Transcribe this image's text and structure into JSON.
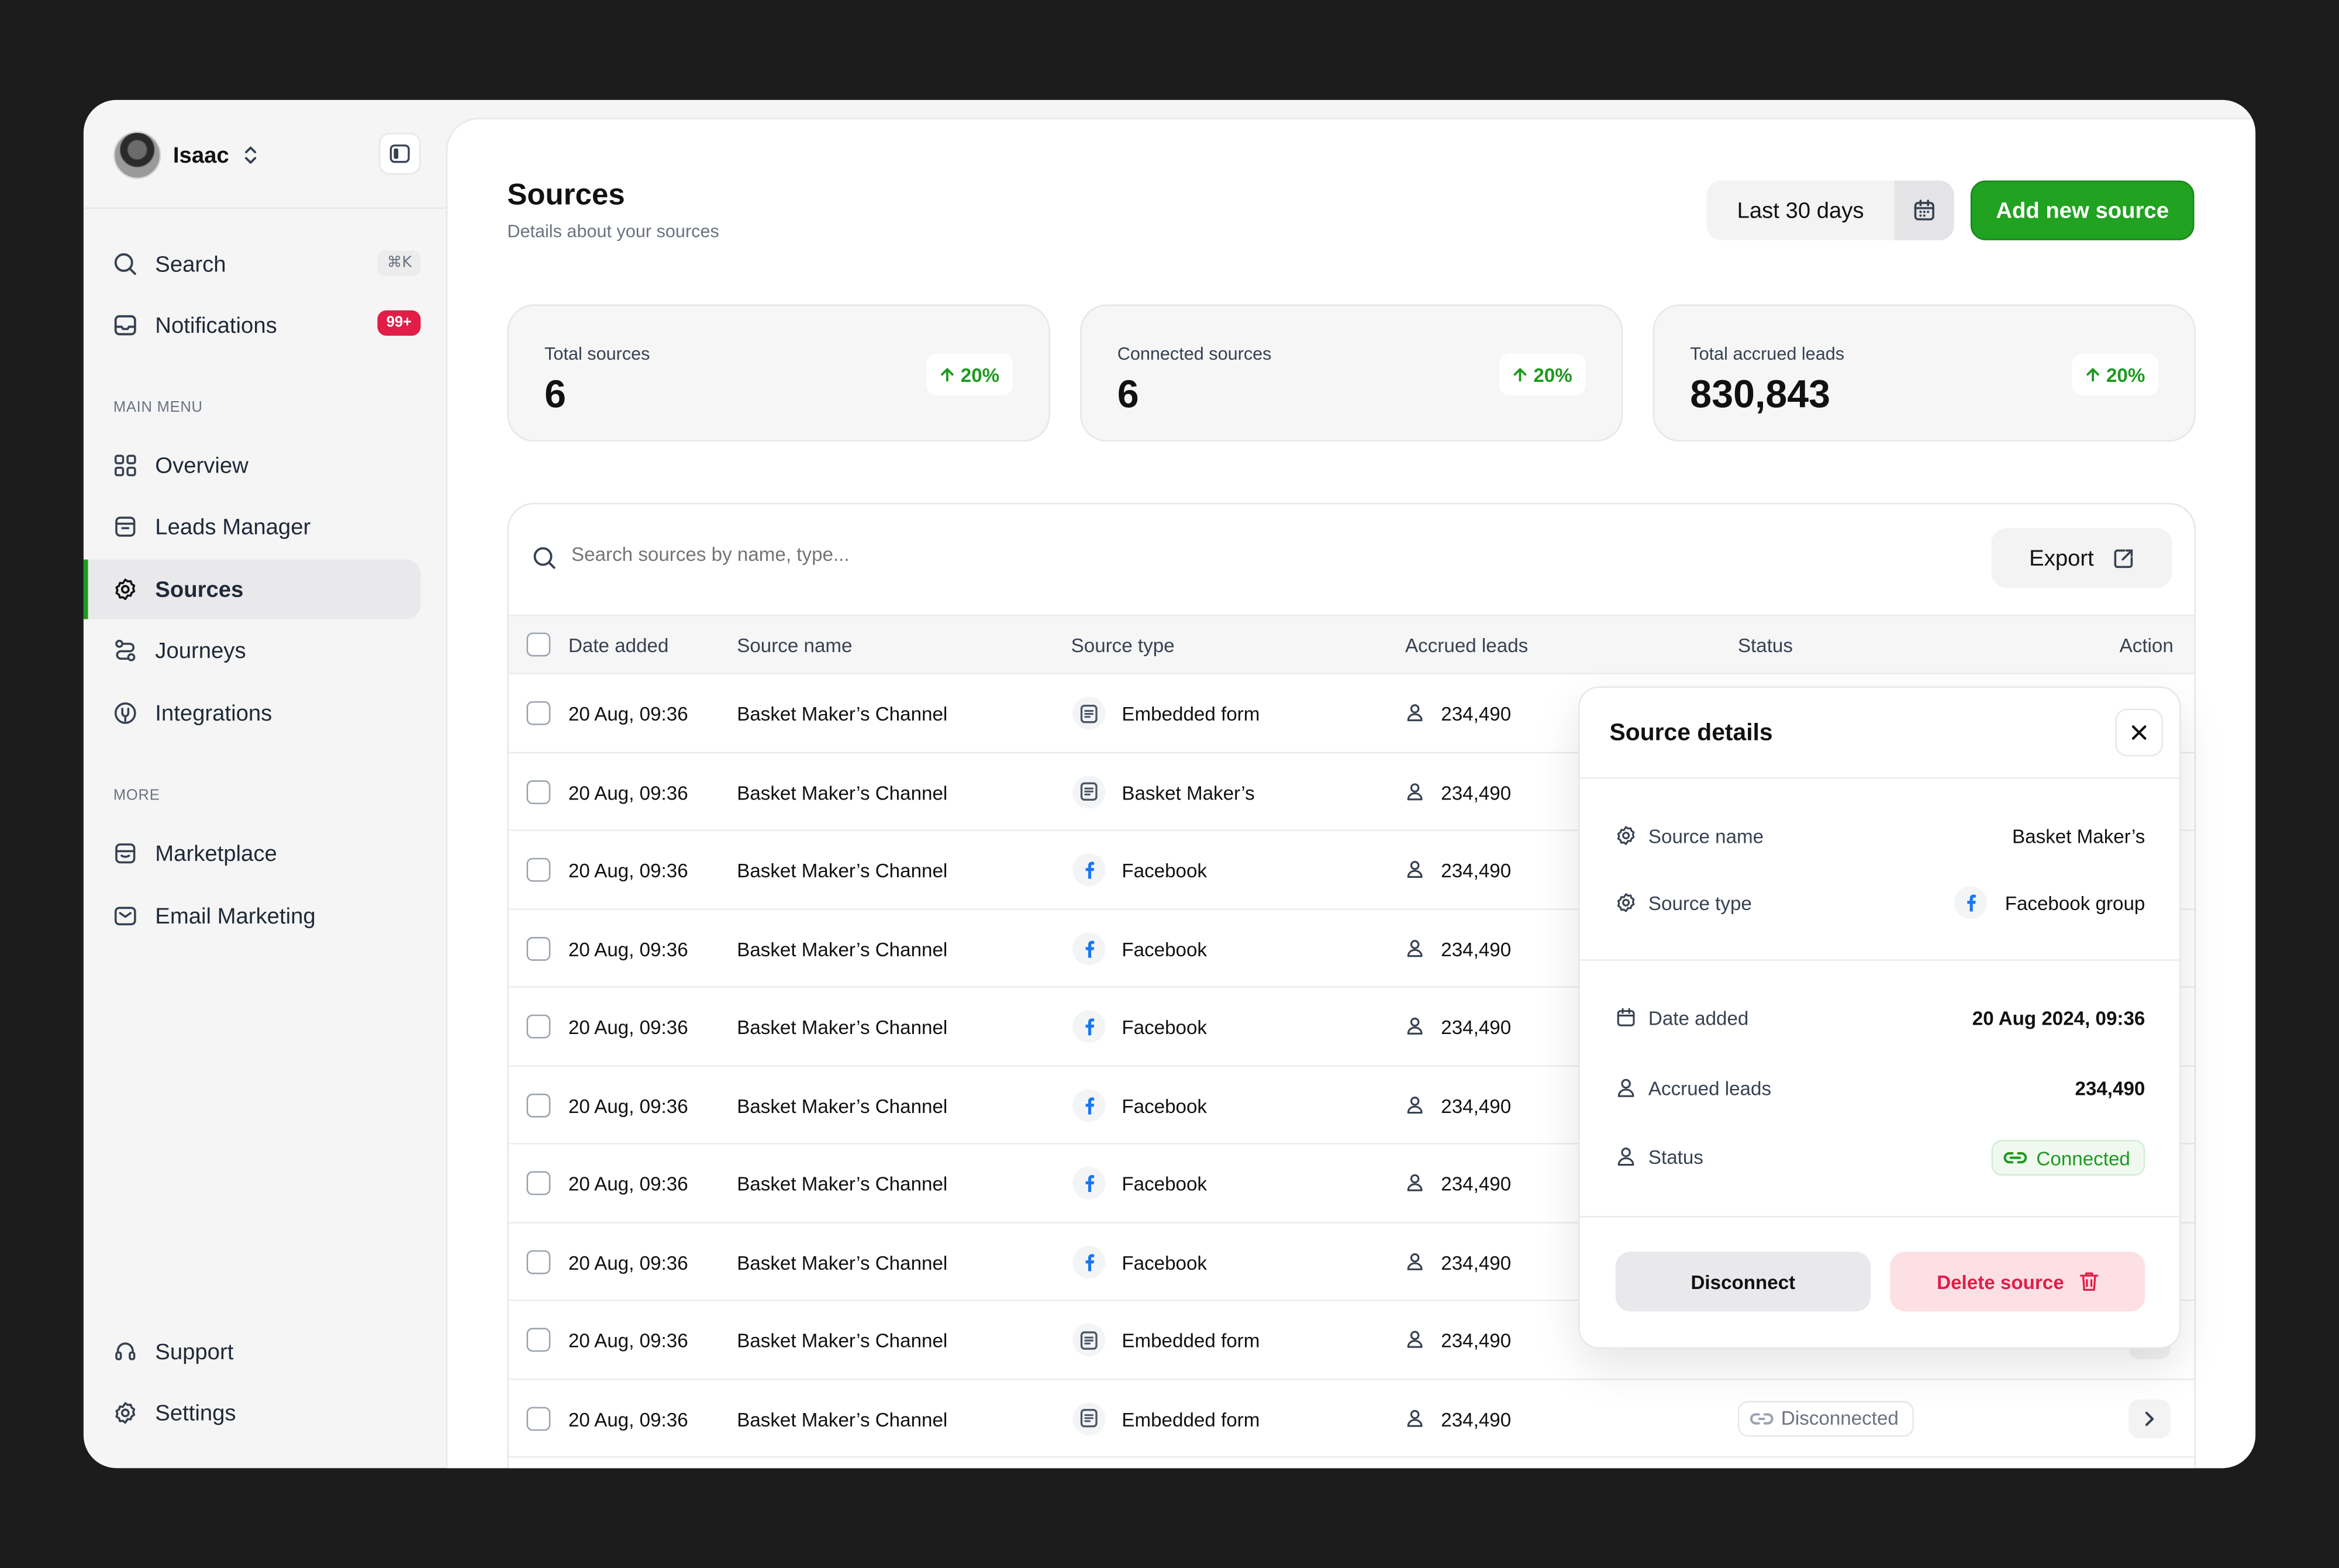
{
  "user": {
    "name": "Isaac"
  },
  "sidebar": {
    "search": {
      "label": "Search",
      "shortcut": "⌘K"
    },
    "notifications": {
      "label": "Notifications",
      "badge": "99+"
    },
    "main_menu_label": "MAIN MENU",
    "main_items": [
      {
        "label": "Overview",
        "icon": "grid-icon"
      },
      {
        "label": "Leads Manager",
        "icon": "box-icon"
      },
      {
        "label": "Sources",
        "icon": "gear-badge-icon",
        "active": true
      },
      {
        "label": "Journeys",
        "icon": "route-icon"
      },
      {
        "label": "Integrations",
        "icon": "puzzle-icon"
      }
    ],
    "more_label": "MORE",
    "more_items": [
      {
        "label": "Marketplace",
        "icon": "store-icon"
      },
      {
        "label": "Email Marketing",
        "icon": "mail-icon"
      }
    ],
    "bottom_items": [
      {
        "label": "Support",
        "icon": "headset-icon"
      },
      {
        "label": "Settings",
        "icon": "gear-icon"
      }
    ]
  },
  "header": {
    "title": "Sources",
    "subtitle": "Details about your sources",
    "date_range": "Last 30 days",
    "add_button": "Add new source"
  },
  "stats": [
    {
      "label": "Total sources",
      "value": "6",
      "change": "20%"
    },
    {
      "label": "Connected sources",
      "value": "6",
      "change": "20%"
    },
    {
      "label": "Total accrued leads",
      "value": "830,843",
      "change": "20%"
    }
  ],
  "table": {
    "search_placeholder": "Search sources by name, type...",
    "export_label": "Export",
    "columns": [
      "Date added",
      "Source name",
      "Source type",
      "Accrued leads",
      "Status",
      "Action"
    ],
    "rows": [
      {
        "date": "20 Aug, 09:36",
        "name": "Basket Maker’s Channel",
        "type": "Embedded form",
        "type_icon": "form-icon",
        "leads": "234,490"
      },
      {
        "date": "20 Aug, 09:36",
        "name": "Basket Maker’s Channel",
        "type": "Basket Maker’s",
        "type_icon": "form-icon",
        "leads": "234,490"
      },
      {
        "date": "20 Aug, 09:36",
        "name": "Basket Maker’s Channel",
        "type": "Facebook",
        "type_icon": "facebook-icon",
        "leads": "234,490"
      },
      {
        "date": "20 Aug, 09:36",
        "name": "Basket Maker’s Channel",
        "type": "Facebook",
        "type_icon": "facebook-icon",
        "leads": "234,490"
      },
      {
        "date": "20 Aug, 09:36",
        "name": "Basket Maker’s Channel",
        "type": "Facebook",
        "type_icon": "facebook-icon",
        "leads": "234,490"
      },
      {
        "date": "20 Aug, 09:36",
        "name": "Basket Maker’s Channel",
        "type": "Facebook",
        "type_icon": "facebook-icon",
        "leads": "234,490"
      },
      {
        "date": "20 Aug, 09:36",
        "name": "Basket Maker’s Channel",
        "type": "Facebook",
        "type_icon": "facebook-icon",
        "leads": "234,490"
      },
      {
        "date": "20 Aug, 09:36",
        "name": "Basket Maker’s Channel",
        "type": "Facebook",
        "type_icon": "facebook-icon",
        "leads": "234,490"
      },
      {
        "date": "20 Aug, 09:36",
        "name": "Basket Maker’s Channel",
        "type": "Embedded form",
        "type_icon": "form-icon",
        "leads": "234,490"
      },
      {
        "date": "20 Aug, 09:36",
        "name": "Basket Maker’s Channel",
        "type": "Embedded form",
        "type_icon": "form-icon",
        "leads": "234,490",
        "status": "Disconnected"
      }
    ]
  },
  "details": {
    "title": "Source details",
    "source_name_label": "Source name",
    "source_name": "Basket Maker’s",
    "source_type_label": "Source type",
    "source_type": "Facebook group",
    "date_added_label": "Date added",
    "date_added": "20 Aug 2024, 09:36",
    "accrued_leads_label": "Accrued leads",
    "accrued_leads": "234,490",
    "status_label": "Status",
    "status": "Connected",
    "disconnect_button": "Disconnect",
    "delete_button": "Delete source"
  },
  "colors": {
    "accent": "#21a221",
    "danger": "#e11d48",
    "facebook": "#1877f2"
  }
}
